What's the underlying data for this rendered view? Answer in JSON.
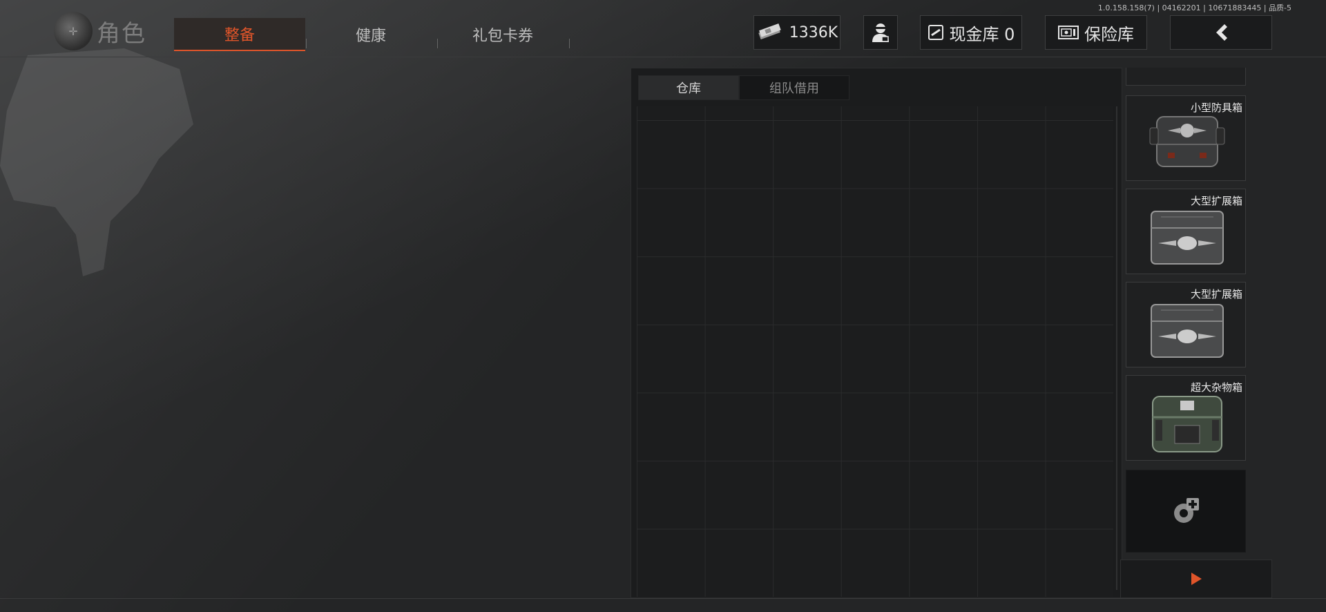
{
  "version_text": "1.0.158.158(7) | 04162201 | 10671883445 | 品质-5",
  "brand": {
    "title": "角色"
  },
  "tabs": [
    {
      "label": "整备",
      "active": true
    },
    {
      "label": "健康",
      "active": false
    },
    {
      "label": "礼包卡券",
      "active": false
    }
  ],
  "currency": {
    "amount": "1336K",
    "icon": "cash-icon"
  },
  "cash_vault": {
    "label": "现金库 0",
    "icon": "card-icon"
  },
  "safe": {
    "label": "保险库",
    "icon": "safe-icon"
  },
  "back_icon": "chevron-left-icon",
  "storage": {
    "tabs": [
      {
        "label": "仓库",
        "active": true
      },
      {
        "label": "组队借用",
        "active": false
      }
    ]
  },
  "containers": [
    {
      "name": "小型防具箱",
      "icon": "armor-case-icon"
    },
    {
      "name": "大型扩展箱",
      "icon": "expansion-case-icon"
    },
    {
      "name": "大型扩展箱",
      "icon": "expansion-case-icon"
    },
    {
      "name": "超大杂物箱",
      "icon": "sundries-case-icon"
    }
  ],
  "add_container_icon": "gear-plus-icon",
  "next_icon": "play-arrow-icon",
  "colors": {
    "accent": "#e0552a",
    "background": "#242526",
    "panel": "#1b1c1d"
  }
}
